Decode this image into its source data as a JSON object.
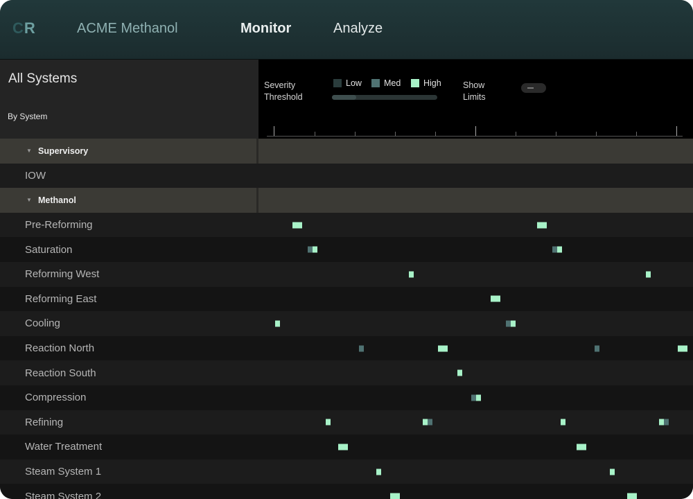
{
  "header": {
    "logo_c": "C",
    "logo_r": "R",
    "app_title": "ACME Methanol",
    "nav_monitor": "Monitor",
    "nav_analyze": "Analyze"
  },
  "sidebar": {
    "title": "All Systems",
    "group_by": "By System"
  },
  "controls": {
    "severity_line1": "Severity",
    "severity_line2": "Threshold",
    "legend": [
      {
        "label": "Low",
        "color": "#2a3c3c"
      },
      {
        "label": "Med",
        "color": "#4f7272"
      },
      {
        "label": "High",
        "color": "#a8f2c8"
      }
    ],
    "threshold_fraction": 0.23,
    "show_limits_line1": "Show",
    "show_limits_line2": "Limits",
    "show_limits_on": false
  },
  "colors": {
    "low": "#2a3c3c",
    "med": "#4f7272",
    "high": "#a8f2c8",
    "row_a": "#1c1c1c",
    "row_b": "#141414",
    "group_bg": "#3b3a35"
  },
  "rows": [
    {
      "label": "Supervisory",
      "type": "group",
      "events": []
    },
    {
      "label": "IOW",
      "type": "row",
      "events": []
    },
    {
      "label": "Methanol",
      "type": "group",
      "events": []
    },
    {
      "label": "Pre-Reforming",
      "type": "row",
      "events": [
        {
          "t": 0.065,
          "sev": [
            "high",
            "high"
          ]
        },
        {
          "t": 0.645,
          "sev": [
            "high",
            "high"
          ]
        }
      ]
    },
    {
      "label": "Saturation",
      "type": "row",
      "events": [
        {
          "t": 0.1,
          "sev": [
            "med",
            "high"
          ]
        },
        {
          "t": 0.682,
          "sev": [
            "med",
            "high"
          ]
        }
      ]
    },
    {
      "label": "Reforming West",
      "type": "row",
      "events": [
        {
          "t": 0.341,
          "sev": [
            "high"
          ]
        },
        {
          "t": 0.904,
          "sev": [
            "high"
          ]
        }
      ]
    },
    {
      "label": "Reforming East",
      "type": "row",
      "events": [
        {
          "t": 0.536,
          "sev": [
            "high",
            "high"
          ]
        }
      ]
    },
    {
      "label": "Cooling",
      "type": "row",
      "events": [
        {
          "t": 0.023,
          "sev": [
            "high"
          ]
        },
        {
          "t": 0.571,
          "sev": [
            "med",
            "high"
          ]
        }
      ]
    },
    {
      "label": "Reaction North",
      "type": "row",
      "events": [
        {
          "t": 0.222,
          "sev": [
            "med"
          ]
        },
        {
          "t": 0.41,
          "sev": [
            "high",
            "high"
          ]
        },
        {
          "t": 0.782,
          "sev": [
            "med"
          ]
        },
        {
          "t": 0.98,
          "sev": [
            "high",
            "high"
          ]
        }
      ]
    },
    {
      "label": "Reaction South",
      "type": "row",
      "events": [
        {
          "t": 0.457,
          "sev": [
            "high"
          ]
        }
      ]
    },
    {
      "label": "Compression",
      "type": "row",
      "events": [
        {
          "t": 0.49,
          "sev": [
            "med",
            "high"
          ]
        }
      ]
    },
    {
      "label": "Refining",
      "type": "row",
      "events": [
        {
          "t": 0.144,
          "sev": [
            "high"
          ]
        },
        {
          "t": 0.374,
          "sev": [
            "high",
            "med"
          ]
        },
        {
          "t": 0.702,
          "sev": [
            "high"
          ]
        },
        {
          "t": 0.935,
          "sev": [
            "high",
            "med"
          ]
        }
      ]
    },
    {
      "label": "Water Treatment",
      "type": "row",
      "events": [
        {
          "t": 0.173,
          "sev": [
            "high",
            "high"
          ]
        },
        {
          "t": 0.74,
          "sev": [
            "high",
            "high"
          ]
        }
      ]
    },
    {
      "label": "Steam System 1",
      "type": "row",
      "events": [
        {
          "t": 0.263,
          "sev": [
            "high"
          ]
        },
        {
          "t": 0.819,
          "sev": [
            "high"
          ]
        }
      ]
    },
    {
      "label": "Steam System 2",
      "type": "row",
      "events": [
        {
          "t": 0.296,
          "sev": [
            "high",
            "high"
          ]
        },
        {
          "t": 0.86,
          "sev": [
            "high",
            "high"
          ]
        }
      ]
    }
  ]
}
